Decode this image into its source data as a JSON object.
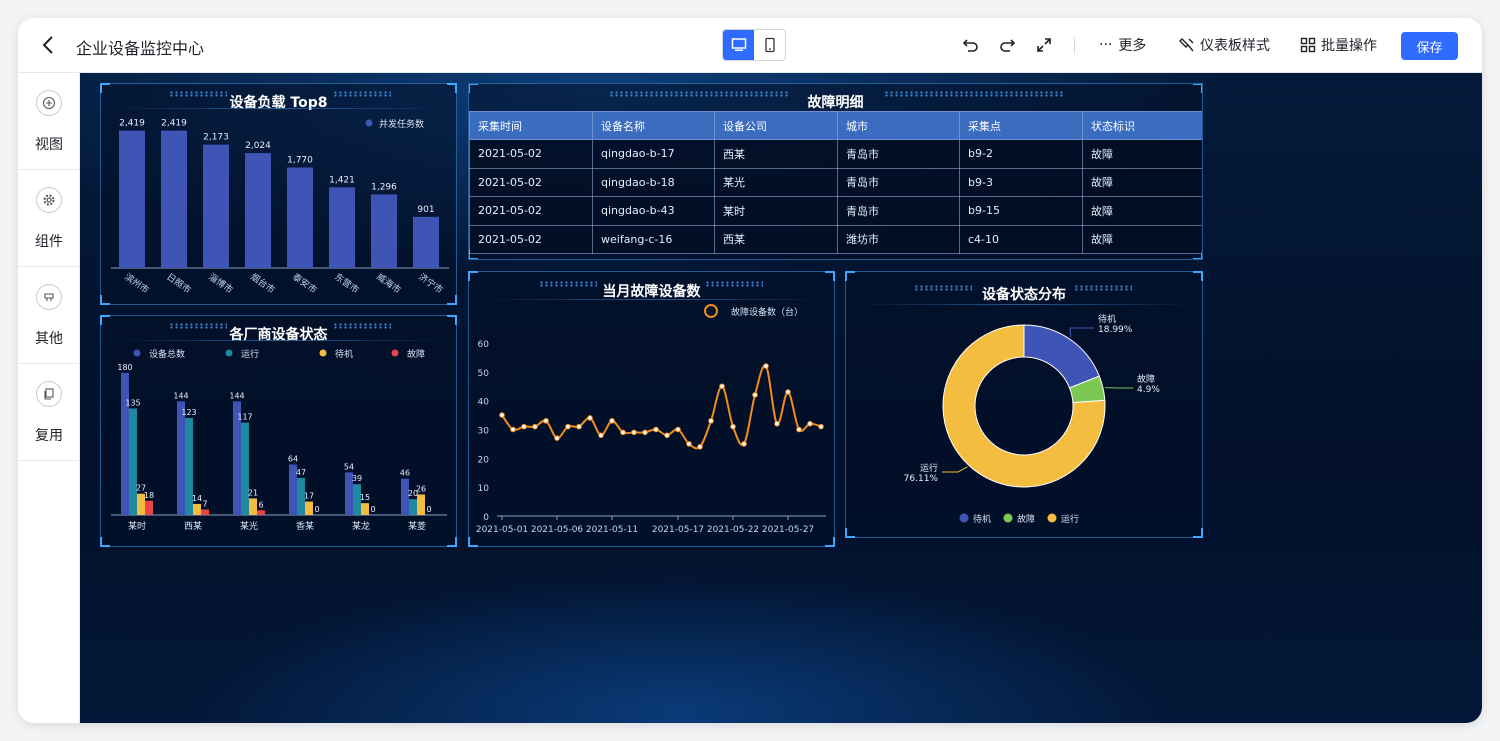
{
  "app": {
    "title": "企业设备监控中心"
  },
  "toolbar": {
    "more": "更多",
    "style": "仪表板样式",
    "batch": "批量操作",
    "save": "保存"
  },
  "sidebar": {
    "items": [
      {
        "label": "视图",
        "icon": "plus-circle-icon"
      },
      {
        "label": "组件",
        "icon": "gear-icon"
      },
      {
        "label": "其他",
        "icon": "misc-icon"
      },
      {
        "label": "复用",
        "icon": "copy-icon"
      }
    ]
  },
  "panels": {
    "load": {
      "title": "设备负载 Top8"
    },
    "vendor": {
      "title": "各厂商设备状态"
    },
    "faults": {
      "title": "故障明细"
    },
    "monthly": {
      "title": "当月故障设备数"
    },
    "status": {
      "title": "设备状态分布"
    }
  },
  "fault_table": {
    "columns": [
      "采集时间",
      "设备名称",
      "设备公司",
      "城市",
      "采集点",
      "状态标识"
    ],
    "rows": [
      [
        "2021-05-02",
        "qingdao-b-17",
        "西某",
        "青岛市",
        "b9-2",
        "故障"
      ],
      [
        "2021-05-02",
        "qingdao-b-18",
        "某光",
        "青岛市",
        "b9-3",
        "故障"
      ],
      [
        "2021-05-02",
        "qingdao-b-43",
        "某时",
        "青岛市",
        "b9-15",
        "故障"
      ],
      [
        "2021-05-02",
        "weifang-c-16",
        "西某",
        "潍坊市",
        "c4-10",
        "故障"
      ]
    ]
  },
  "colors": {
    "accent": "#2f6bff",
    "bar": "#3f55b5",
    "line": "#f08c1c",
    "waiting": "#3f55b5",
    "fault": "#7cc653",
    "running": "#f5bd3f"
  },
  "chart_data": [
    {
      "type": "bar",
      "title": "设备负载 Top8",
      "categories": [
        "滨州市",
        "日照市",
        "淄博市",
        "烟台市",
        "泰安市",
        "东营市",
        "威海市",
        "济宁市"
      ],
      "series": [
        {
          "name": "并发任务数",
          "values": [
            2419,
            2419,
            2173,
            2024,
            1770,
            1421,
            1296,
            901
          ]
        }
      ],
      "value_labels": [
        "2,419",
        "2,419",
        "2,173",
        "2,024",
        "1,770",
        "1,421",
        "1,296",
        "901"
      ],
      "ylim": [
        0,
        2800
      ],
      "legend": "top-right",
      "grid": false
    },
    {
      "type": "bar",
      "title": "各厂商设备状态",
      "categories": [
        "某时",
        "西某",
        "某光",
        "香某",
        "某龙",
        "某菱"
      ],
      "series": [
        {
          "name": "设备总数",
          "color": "#3f55b5",
          "values": [
            180,
            144,
            144,
            64,
            54,
            46
          ]
        },
        {
          "name": "运行",
          "color": "#1e88a0",
          "values": [
            135,
            123,
            117,
            47,
            39,
            20
          ]
        },
        {
          "name": "待机",
          "color": "#f5bd3f",
          "values": [
            27,
            14,
            21,
            17,
            15,
            26
          ]
        },
        {
          "name": "故障",
          "color": "#e8454d",
          "values": [
            18,
            7,
            6,
            0,
            0,
            0
          ]
        }
      ],
      "ylim": [
        0,
        190
      ],
      "legend": "top",
      "grid": false
    },
    {
      "type": "line",
      "title": "当月故障设备数",
      "series": [
        {
          "name": "故障设备数（台）",
          "values": [
            35,
            30,
            31,
            31,
            33,
            27,
            31,
            31,
            34,
            28,
            33,
            29,
            29,
            29,
            30,
            28,
            30,
            25,
            24,
            33,
            45,
            31,
            25,
            42,
            52,
            32,
            43,
            30,
            32,
            31
          ]
        }
      ],
      "x_start": "2021-05-01",
      "x_tick_labels": [
        "2021-05-01",
        "2021-05-06",
        "2021-05-11",
        "2021-05-17",
        "2021-05-22",
        "2021-05-27"
      ],
      "yticks": [
        "0",
        "10",
        "20",
        "30",
        "40",
        "50",
        "60"
      ],
      "ylim": [
        0,
        60
      ],
      "legend": "top-right",
      "grid": false
    },
    {
      "type": "pie",
      "title": "设备状态分布",
      "slices": [
        {
          "name": "待机",
          "value": 18.99,
          "label": "18.99%",
          "color": "#3f55b5"
        },
        {
          "name": "故障",
          "value": 4.9,
          "label": "4.9%",
          "color": "#7cc653"
        },
        {
          "name": "运行",
          "value": 76.11,
          "label": "76.11%",
          "color": "#f5bd3f"
        }
      ],
      "donut": true,
      "legend": "bottom"
    }
  ]
}
